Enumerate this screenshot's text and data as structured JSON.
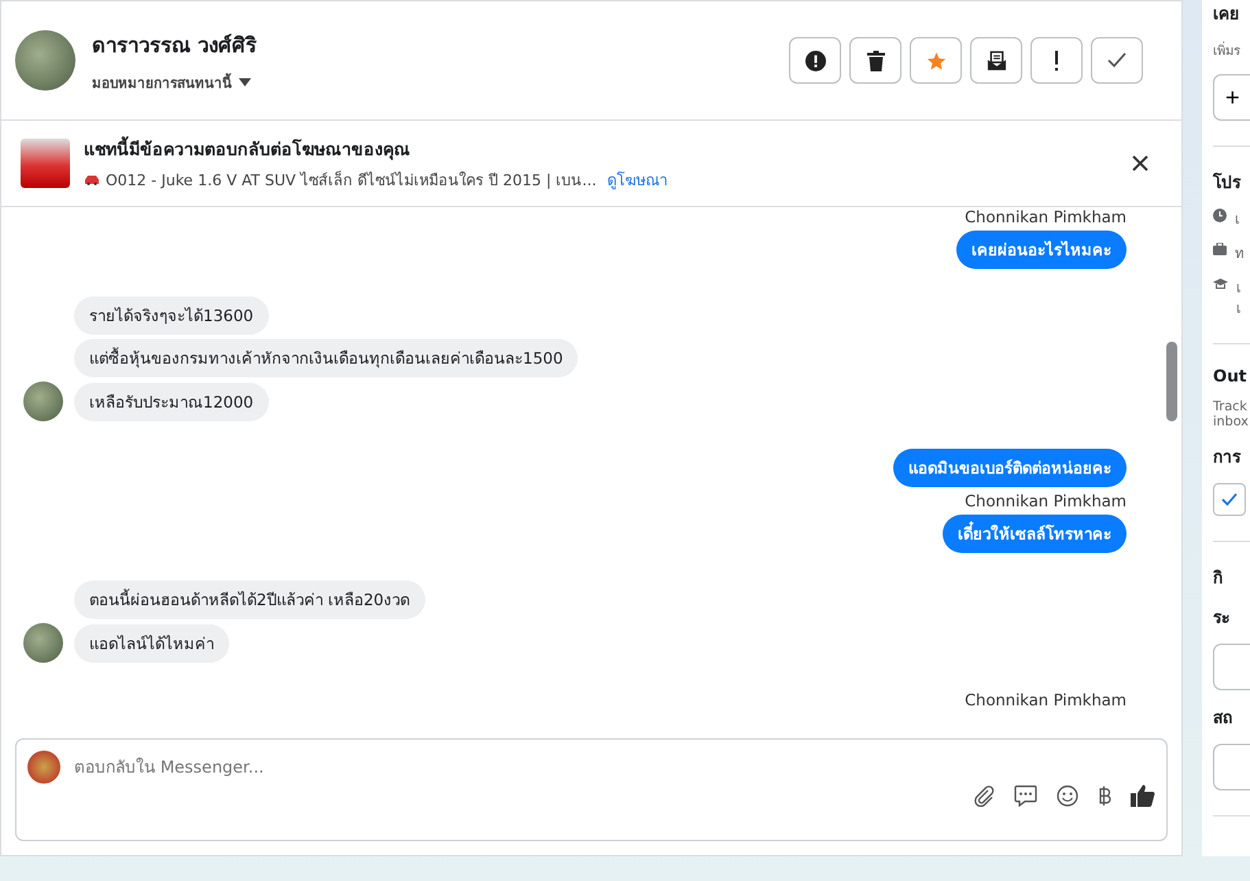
{
  "contact": {
    "name": "ดาราวรรณ วงศ์ศิริ",
    "assign_label": "มอบหมายการสนทนานี้"
  },
  "header_actions": [
    {
      "kind": "spam"
    },
    {
      "kind": "delete"
    },
    {
      "kind": "star"
    },
    {
      "kind": "unread"
    },
    {
      "kind": "important"
    },
    {
      "kind": "done"
    }
  ],
  "ad_notice": {
    "title": "แชทนี้มีข้อความตอบกลับต่อโฆษณาของคุณ",
    "detail": "O012 - Juke 1.6 V AT SUV ไซส์เล็ก ดีไซน์ไม่เหมือนใคร ปี 2015 | เบน...",
    "link": "ดูโฆษณา"
  },
  "groups": [
    {
      "outgoing": true,
      "items": [
        {
          "kind": "sender",
          "text": "Chonnikan Pimkham"
        },
        {
          "kind": "message",
          "text": "เคยผ่อนอะไรไหมคะ"
        }
      ]
    },
    {
      "outgoing": false,
      "items": [
        {
          "kind": "message",
          "text": "รายได้จริงๆจะได้13600"
        },
        {
          "kind": "message",
          "text": "แต่ซื้อหุ้นของกรมทางเค้าหักจากเงินเดือนทุกเดือนเลยค่าเดือนละ1500"
        },
        {
          "kind": "message",
          "text": "เหลือรับประมาณ12000"
        }
      ]
    },
    {
      "outgoing": true,
      "items": [
        {
          "kind": "message",
          "text": "แอดมินขอเบอร์ติดต่อหน่อยคะ"
        },
        {
          "kind": "sender",
          "text": "Chonnikan Pimkham"
        },
        {
          "kind": "message",
          "text": "เดี๋ยวให้เซลล์โทรหาคะ"
        }
      ]
    },
    {
      "outgoing": false,
      "items": [
        {
          "kind": "message",
          "text": "ตอนนี้ผ่อนฮอนด้าหลีดได้2ปีแล้วค่า เหลือ20งวด"
        },
        {
          "kind": "message",
          "text": "แอดไลน์ได้ไหมค่า"
        }
      ]
    },
    {
      "outgoing": true,
      "items": [
        {
          "kind": "sender",
          "text": "Chonnikan Pimkham"
        }
      ]
    }
  ],
  "composer": {
    "placeholder": "ตอบกลับใน Messenger..."
  },
  "side_panel": {
    "sections": [
      {
        "title": "เคย",
        "lines": [
          {
            "kind": "note",
            "text": "เพิ่มร"
          },
          {
            "kind": "button",
            "text": "+"
          }
        ]
      },
      {
        "title": "โปร",
        "lines": [
          {
            "kind": "clock",
            "text": "เ"
          },
          {
            "kind": "work",
            "text": "ท"
          },
          {
            "kind": "school",
            "text": "เ\nเ"
          }
        ]
      },
      {
        "title": "Out",
        "lines": [
          {
            "kind": "note",
            "text": "Track\ninbox"
          },
          {
            "kind": "heading",
            "text": "การ"
          },
          {
            "kind": "checkbox",
            "checked": true
          }
        ]
      },
      {
        "title": "กิ",
        "lines": [
          {
            "kind": "heading",
            "text": "ระ"
          },
          {
            "kind": "field"
          },
          {
            "kind": "heading",
            "text": "สถ"
          },
          {
            "kind": "field"
          }
        ]
      }
    ]
  }
}
